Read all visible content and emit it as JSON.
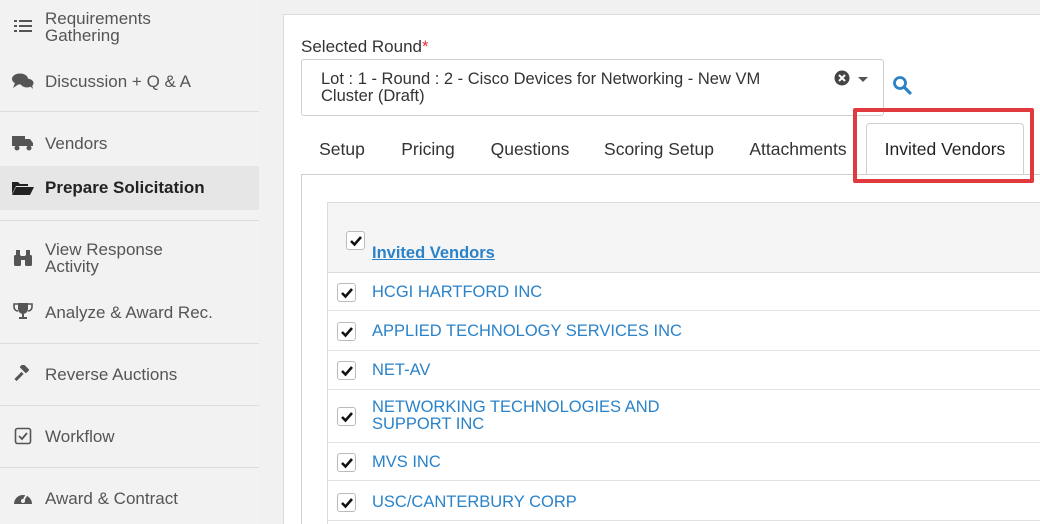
{
  "sidebar": {
    "items": [
      {
        "label": "Requirements Gathering",
        "icon": "list-icon"
      },
      {
        "label": "Discussion + Q & A",
        "icon": "comments-icon"
      },
      {
        "label": "Vendors",
        "icon": "truck-icon"
      },
      {
        "label": "Prepare Solicitation",
        "icon": "folder-open-icon",
        "active": true
      },
      {
        "label": "View Response Activity",
        "icon": "binoculars-icon"
      },
      {
        "label": "Analyze & Award Rec.",
        "icon": "trophy-icon"
      },
      {
        "label": "Reverse Auctions",
        "icon": "gavel-icon"
      },
      {
        "label": "Workflow",
        "icon": "check-square-icon"
      },
      {
        "label": "Award & Contract",
        "icon": "dashboard-icon"
      }
    ]
  },
  "round": {
    "label": "Selected Round",
    "required_mark": "*",
    "value": "Lot : 1 - Round : 2 - Cisco Devices for Networking - New VM Cluster (Draft)"
  },
  "tabs": [
    "Setup",
    "Pricing",
    "Questions",
    "Scoring Setup",
    "Attachments",
    "Invited Vendors"
  ],
  "active_tab": "Invited Vendors",
  "vendors": {
    "header": "Invited Vendors",
    "header_checked": true,
    "rows": [
      {
        "name": "HCGI HARTFORD INC",
        "checked": true
      },
      {
        "name": "APPLIED TECHNOLOGY SERVICES INC",
        "checked": true
      },
      {
        "name": "NET-AV",
        "checked": true
      },
      {
        "name": "NETWORKING TECHNOLOGIES AND SUPPORT INC",
        "checked": true
      },
      {
        "name": "MVS INC",
        "checked": true
      },
      {
        "name": "USC/CANTERBURY CORP",
        "checked": true
      }
    ]
  },
  "colors": {
    "link": "#2a82c9",
    "highlight": "#e03a3e",
    "required": "#d9363e"
  }
}
